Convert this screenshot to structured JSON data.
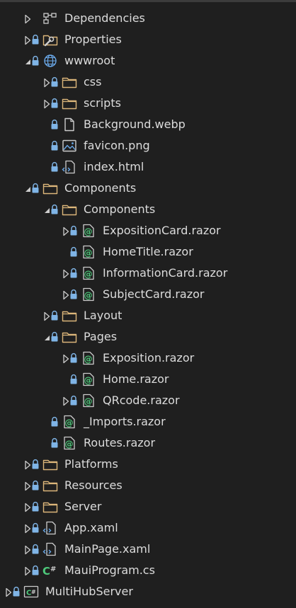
{
  "solution_explorer": {
    "items": [
      {
        "label": "Dependencies",
        "level": 1,
        "state": "collapsed",
        "lock": false,
        "icon": "dependencies"
      },
      {
        "label": "Properties",
        "level": 1,
        "state": "collapsed",
        "lock": true,
        "icon": "properties"
      },
      {
        "label": "wwwroot",
        "level": 1,
        "state": "expanded",
        "lock": true,
        "icon": "globe"
      },
      {
        "label": "css",
        "level": 2,
        "state": "collapsed",
        "lock": true,
        "icon": "folder"
      },
      {
        "label": "scripts",
        "level": 2,
        "state": "collapsed",
        "lock": true,
        "icon": "folder"
      },
      {
        "label": "Background.webp",
        "level": 2,
        "state": "none",
        "lock": true,
        "icon": "file"
      },
      {
        "label": "favicon.png",
        "level": 2,
        "state": "none",
        "lock": true,
        "icon": "image"
      },
      {
        "label": "index.html",
        "level": 2,
        "state": "none",
        "lock": true,
        "icon": "code-file"
      },
      {
        "label": "Components",
        "level": 1,
        "state": "expanded",
        "lock": true,
        "icon": "folder"
      },
      {
        "label": "Components",
        "level": 2,
        "state": "expanded",
        "lock": true,
        "icon": "folder"
      },
      {
        "label": "ExpositionCard.razor",
        "level": 3,
        "state": "collapsed",
        "lock": true,
        "icon": "razor"
      },
      {
        "label": "HomeTitle.razor",
        "level": 3,
        "state": "none",
        "lock": true,
        "icon": "razor"
      },
      {
        "label": "InformationCard.razor",
        "level": 3,
        "state": "collapsed",
        "lock": true,
        "icon": "razor"
      },
      {
        "label": "SubjectCard.razor",
        "level": 3,
        "state": "collapsed",
        "lock": true,
        "icon": "razor"
      },
      {
        "label": "Layout",
        "level": 2,
        "state": "collapsed",
        "lock": true,
        "icon": "folder"
      },
      {
        "label": "Pages",
        "level": 2,
        "state": "expanded",
        "lock": true,
        "icon": "folder"
      },
      {
        "label": "Exposition.razor",
        "level": 3,
        "state": "collapsed",
        "lock": true,
        "icon": "razor"
      },
      {
        "label": "Home.razor",
        "level": 3,
        "state": "none",
        "lock": true,
        "icon": "razor"
      },
      {
        "label": "QRcode.razor",
        "level": 3,
        "state": "collapsed",
        "lock": true,
        "icon": "razor"
      },
      {
        "label": "_Imports.razor",
        "level": 2,
        "state": "none",
        "lock": true,
        "icon": "razor"
      },
      {
        "label": "Routes.razor",
        "level": 2,
        "state": "none",
        "lock": true,
        "icon": "razor"
      },
      {
        "label": "Platforms",
        "level": 1,
        "state": "collapsed",
        "lock": true,
        "icon": "folder"
      },
      {
        "label": "Resources",
        "level": 1,
        "state": "collapsed",
        "lock": true,
        "icon": "folder"
      },
      {
        "label": "Server",
        "level": 1,
        "state": "collapsed",
        "lock": true,
        "icon": "folder"
      },
      {
        "label": "App.xaml",
        "level": 1,
        "state": "collapsed",
        "lock": true,
        "icon": "code-file"
      },
      {
        "label": "MainPage.xaml",
        "level": 1,
        "state": "collapsed",
        "lock": true,
        "icon": "code-file"
      },
      {
        "label": "MauiProgram.cs",
        "level": 1,
        "state": "collapsed",
        "lock": true,
        "icon": "csharp"
      },
      {
        "label": "MultiHubServer",
        "level": 0,
        "state": "collapsed",
        "lock": true,
        "icon": "csharp-project"
      }
    ]
  },
  "colors": {
    "background": "#1f1f1f",
    "text": "#dcdcdc",
    "glyph": "#cccccc",
    "lock": "#7fb4e6",
    "folder": "#dcb67a",
    "razor_green": "#4ec97b",
    "globe_blue": "#6aa8e8",
    "csharp_green": "#4ec97b"
  }
}
